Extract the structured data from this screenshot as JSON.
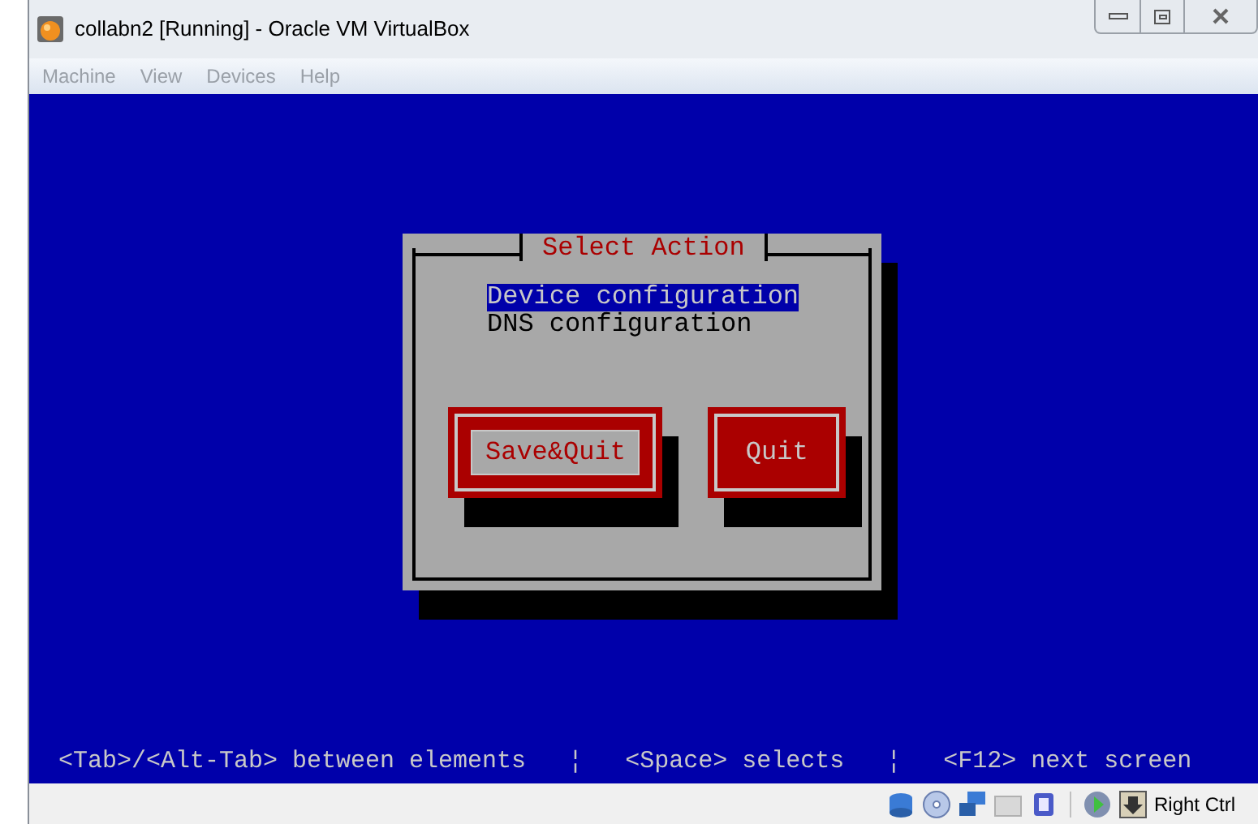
{
  "window": {
    "title": "collabn2 [Running] - Oracle VM VirtualBox"
  },
  "menu": [
    {
      "label": "Machine",
      "disabled": true
    },
    {
      "label": "View",
      "disabled": true
    },
    {
      "label": "Devices",
      "disabled": true
    },
    {
      "label": "Help",
      "disabled": true
    }
  ],
  "dialog": {
    "title": "Select Action",
    "items": [
      {
        "label": "Device configuration",
        "selected": true
      },
      {
        "label": "DNS configuration",
        "selected": false
      }
    ],
    "buttons": [
      {
        "label": "Save&Quit",
        "focused": true
      },
      {
        "label": "Quit",
        "focused": false
      }
    ]
  },
  "footer": {
    "hints": [
      "<Tab>/<Alt-Tab> between elements",
      "<Space> selects",
      "<F12> next screen"
    ],
    "separator": "¦"
  },
  "status_bar": {
    "host_key": "Right Ctrl"
  }
}
